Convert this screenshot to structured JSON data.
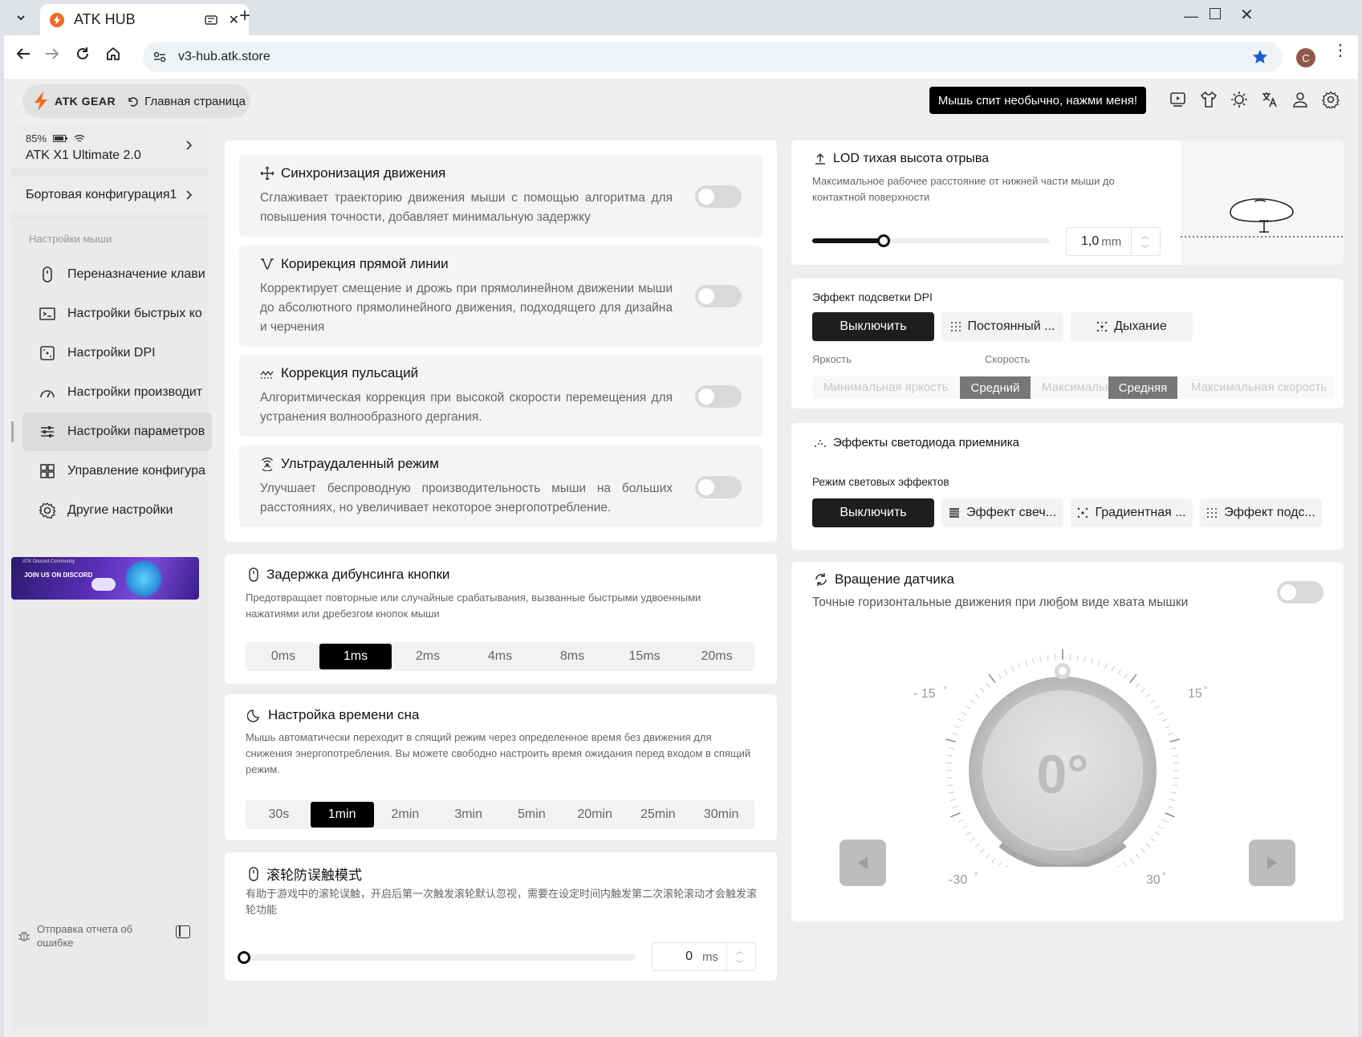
{
  "browser": {
    "tab_title": "ATK HUB",
    "url": "v3-hub.atk.store",
    "profile_initial": "C"
  },
  "header": {
    "brand": "ATK GEAR",
    "home_label": "Главная страница",
    "alert_button": "Мышь спит необычно, нажми меня!"
  },
  "sidebar": {
    "battery": "85%",
    "device_name": "ATK X1 Ultimate 2.0",
    "config_name": "Бортовая конфигурация1",
    "section_label": "Настройки мыши",
    "items": [
      {
        "label": "Переназначение клави",
        "icon": "mouse-icon"
      },
      {
        "label": "Настройки быстрых ко",
        "icon": "terminal-icon"
      },
      {
        "label": "Настройки DPI",
        "icon": "dpi-icon"
      },
      {
        "label": "Настройки производит",
        "icon": "gauge-icon"
      },
      {
        "label": "Настройки параметров",
        "icon": "sliders-icon"
      },
      {
        "label": "Управление конфигура",
        "icon": "grid-icon"
      },
      {
        "label": "Другие настройки",
        "icon": "gear-icon"
      }
    ],
    "banner_line1": "ATK Discord Community",
    "banner_line2": "JOIN US ON DISCORD",
    "report_label": "Отправка отчета об ошибке"
  },
  "features": [
    {
      "title": "Синхронизация движения",
      "desc": "Сглаживает траекторию движения мыши с помощью алгоритма для повышения точности, добавляет минимальную задержку",
      "enabled": false
    },
    {
      "title": "Корирекция прямой линии",
      "desc": "Корректирует смещение и дрожь при прямолинейном движении мыши до абсолютного прямолинейного движения, подходящего для дизайна и черчения",
      "enabled": false
    },
    {
      "title": "Коррекция пульсаций",
      "desc": "Алгоритмическая коррекция при высокой скорости перемещения для устранения волнообразного дергания.",
      "enabled": false
    },
    {
      "title": "Ультраудаленный режим",
      "desc": "Улучшает беспроводную производительность мыши на больших расстояниях, но увеличивает некоторое энергопотребление.",
      "enabled": false
    }
  ],
  "debounce": {
    "title": "Задержка дибунсинга кнопки",
    "desc": "Предотвращает повторные или случайные срабатывания, вызванные быстрыми удвоенными нажатиями или дребезгом кнопок мыши",
    "options": [
      "0ms",
      "1ms",
      "2ms",
      "4ms",
      "8ms",
      "15ms",
      "20ms"
    ],
    "selected": "1ms"
  },
  "sleep": {
    "title": "Настройка времени сна",
    "desc": "Мышь автоматически переходит в спящий режим через определенное время без движения для снижения энергопотребления. Вы можете свободно настроить время ожидания перед входом в спящий режим.",
    "options": [
      "30s",
      "1min",
      "2min",
      "3min",
      "5min",
      "20min",
      "25min",
      "30min"
    ],
    "selected": "1min"
  },
  "wheel": {
    "title": "滚轮防误触模式",
    "desc": "有助于游戏中的滚轮误触，开启后第一次触发滚轮默认忽视，需要在设定时间内触发第二次滚轮滚动才会触发滚轮功能",
    "value": "0",
    "unit": "ms",
    "slider_fraction": 0
  },
  "lod": {
    "title": "LOD тихая высота отрыва",
    "desc": "Максимальное рабочее расстояние от нижней части мыши до контактной поверхности",
    "value": "1,0",
    "unit": "mm",
    "slider_fraction": 0.3
  },
  "dpi_light": {
    "title": "Эффект подсветки DPI",
    "modes": [
      "Выключить",
      "Постоянный ...",
      "Дыхание"
    ],
    "selected": "Выключить",
    "brightness_label": "Яркость",
    "speed_label": "Скорость",
    "bright_min": "Минимальная яркость",
    "bright_mid": "Средний",
    "bright_max": "Максимальная",
    "speed_mid": "Средняя",
    "speed_max": "Максимальная скорость"
  },
  "receiver": {
    "title": "Эффекты светодиода приемника",
    "mode_label": "Режим световых эффектов",
    "modes": [
      "Выключить",
      "Эффект свеч...",
      "Градиентная ...",
      "Эффект подс..."
    ],
    "selected": "Выключить"
  },
  "rotation": {
    "title": "Вращение датчика",
    "desc": "Точные горизонтальные движения при любом виде хвата мышки",
    "enabled": false,
    "value": "0°",
    "tick_0": "0",
    "tick_m15": "- 15",
    "tick_p15": "15",
    "tick_m30": "-30",
    "tick_p30": "30",
    "deg": "°"
  }
}
